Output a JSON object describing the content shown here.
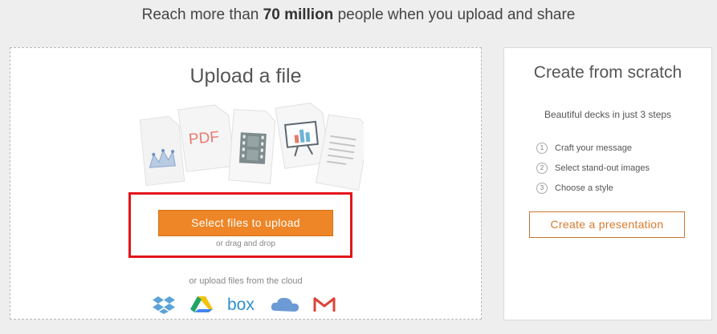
{
  "header": {
    "prefix": "Reach more than ",
    "highlight": "70 million",
    "suffix": " people when you upload and share"
  },
  "upload": {
    "title": "Upload a file",
    "file_icons": [
      "chart-file-icon",
      "pdf-file-icon",
      "video-file-icon",
      "presentation-file-icon",
      "document-file-icon"
    ],
    "pdf_label": "PDF",
    "select_button": "Select files to upload",
    "drag_text": "or drag and drop",
    "cloud_text": "or upload files from the cloud",
    "cloud_services": [
      "dropbox-icon",
      "google-drive-icon",
      "box-icon",
      "onedrive-icon",
      "gmail-icon"
    ],
    "box_label": "box",
    "highlight_color": "#e3151a",
    "button_color": "#ee8526"
  },
  "scratch": {
    "title": "Create from scratch",
    "subtitle": "Beautiful decks in just 3 steps",
    "steps": [
      {
        "num": "1",
        "label": "Craft your message"
      },
      {
        "num": "2",
        "label": "Select stand-out images"
      },
      {
        "num": "3",
        "label": "Choose a style"
      }
    ],
    "create_button": "Create a presentation"
  }
}
